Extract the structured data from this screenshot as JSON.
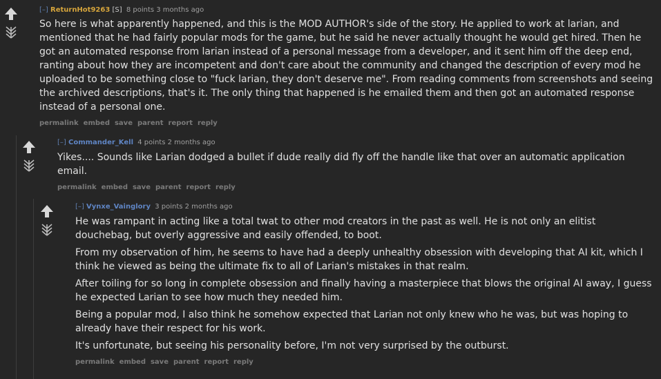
{
  "comments": [
    {
      "expand": "[–]",
      "author": "ReturnHot9263",
      "flag": "[S]",
      "score": "8 points 3 months ago",
      "paragraphs": [
        "So here is what apparently happened, and this is the MOD AUTHOR's side of the story. He applied to work at larian, and mentioned that he had fairly popular mods for the game, but he said he never actually thought he would get hired. Then he got an automated response from larian instead of a personal message from a developer, and it sent him off the deep end, ranting about how they are incompetent and don't care about the community and changed the description of every mod he uploaded to be something close to \"fuck larian, they don't deserve me\". From reading comments from screenshots and seeing the archived descriptions, that's it. The only thing that happened is he emailed them and then got an automated response instead of a personal one."
      ],
      "buttons": [
        "permalink",
        "embed",
        "save",
        "parent",
        "report",
        "reply"
      ]
    },
    {
      "expand": "[–]",
      "author": "Commander_Kell",
      "score": "4 points 2 months ago",
      "paragraphs": [
        "Yikes.... Sounds like Larian dodged a bullet if dude really did fly off the handle like that over an automatic application email."
      ],
      "buttons": [
        "permalink",
        "embed",
        "save",
        "parent",
        "report",
        "reply"
      ]
    },
    {
      "expand": "[–]",
      "author": "Vynxe_Vainglory",
      "score": "3 points 2 months ago",
      "paragraphs": [
        "He was rampant in acting like a total twat to other mod creators in the past as well. He is not only an elitist douchebag, but overly aggressive and easily offended, to boot.",
        "From my observation of him, he seems to have had a deeply unhealthy obsession with developing that AI kit, which I think he viewed as being the ultimate fix to all of Larian's mistakes in that realm.",
        "After toiling for so long in complete obsession and finally having a masterpiece that blows the original AI away, I guess he expected Larian to see how much they needed him.",
        "Being a popular mod, I also think he somehow expected that Larian not only knew who he was, but was hoping to already have their respect for his work.",
        "It's unfortunate, but seeing his personality before, I'm not very surprised by the outburst."
      ],
      "buttons": [
        "permalink",
        "embed",
        "save",
        "parent",
        "report",
        "reply"
      ]
    }
  ]
}
